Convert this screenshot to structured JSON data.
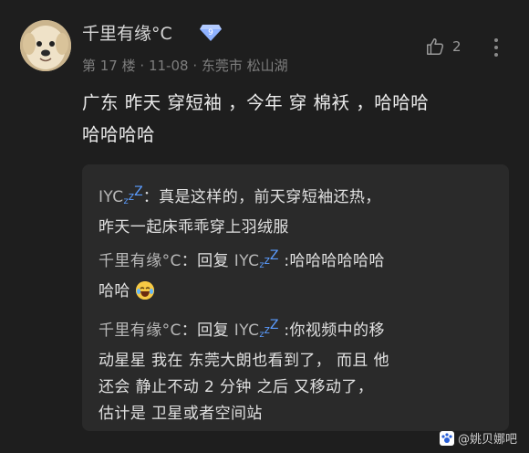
{
  "post": {
    "author": "千里有缘°C",
    "level_badge": "9",
    "floor": "第 17 楼",
    "date": "11-08",
    "location": "东莞市 松山湖",
    "likes": "2",
    "content_line1": "广东 昨天 穿短袖 ，今年 穿 棉袄 ，哈哈哈",
    "content_line2": "哈哈哈哈"
  },
  "replies": [
    {
      "author_prefix": "IYC",
      "line1_text": "：真是这样的，前天穿短袖还热，",
      "line2": "昨天一起床乖乖穿上羽绒服"
    },
    {
      "author": "千里有缘°C",
      "reply_word": "：回复",
      "target_prefix": "IYC",
      "line1_text": ":哈哈哈哈哈哈",
      "line2_text": "哈哈"
    },
    {
      "author": "千里有缘°C",
      "reply_word": "：回复",
      "target_prefix": "IYC",
      "line1_text": ":你视频中的移",
      "line2": "动星星 我在 东莞大朗也看到了， 而且 他",
      "line3": "还会 静止不动 2 分钟 之后 又移动了，",
      "line4": "估计是 卫星或者空间站"
    }
  ],
  "watermark": "@姚贝娜吧",
  "colors": {
    "background": "#1e1e1e",
    "reply_box": "#2a2a2a",
    "badge_blue": "#7aa6ff",
    "zzz_blue": "#5b9cff"
  },
  "icons": {
    "badge": "diamond-badge-icon",
    "like": "thumbs-up-icon",
    "more": "vertical-dots-icon",
    "emoji": "laughing-tears-emoji",
    "zzz": "sleep-z-icon"
  }
}
